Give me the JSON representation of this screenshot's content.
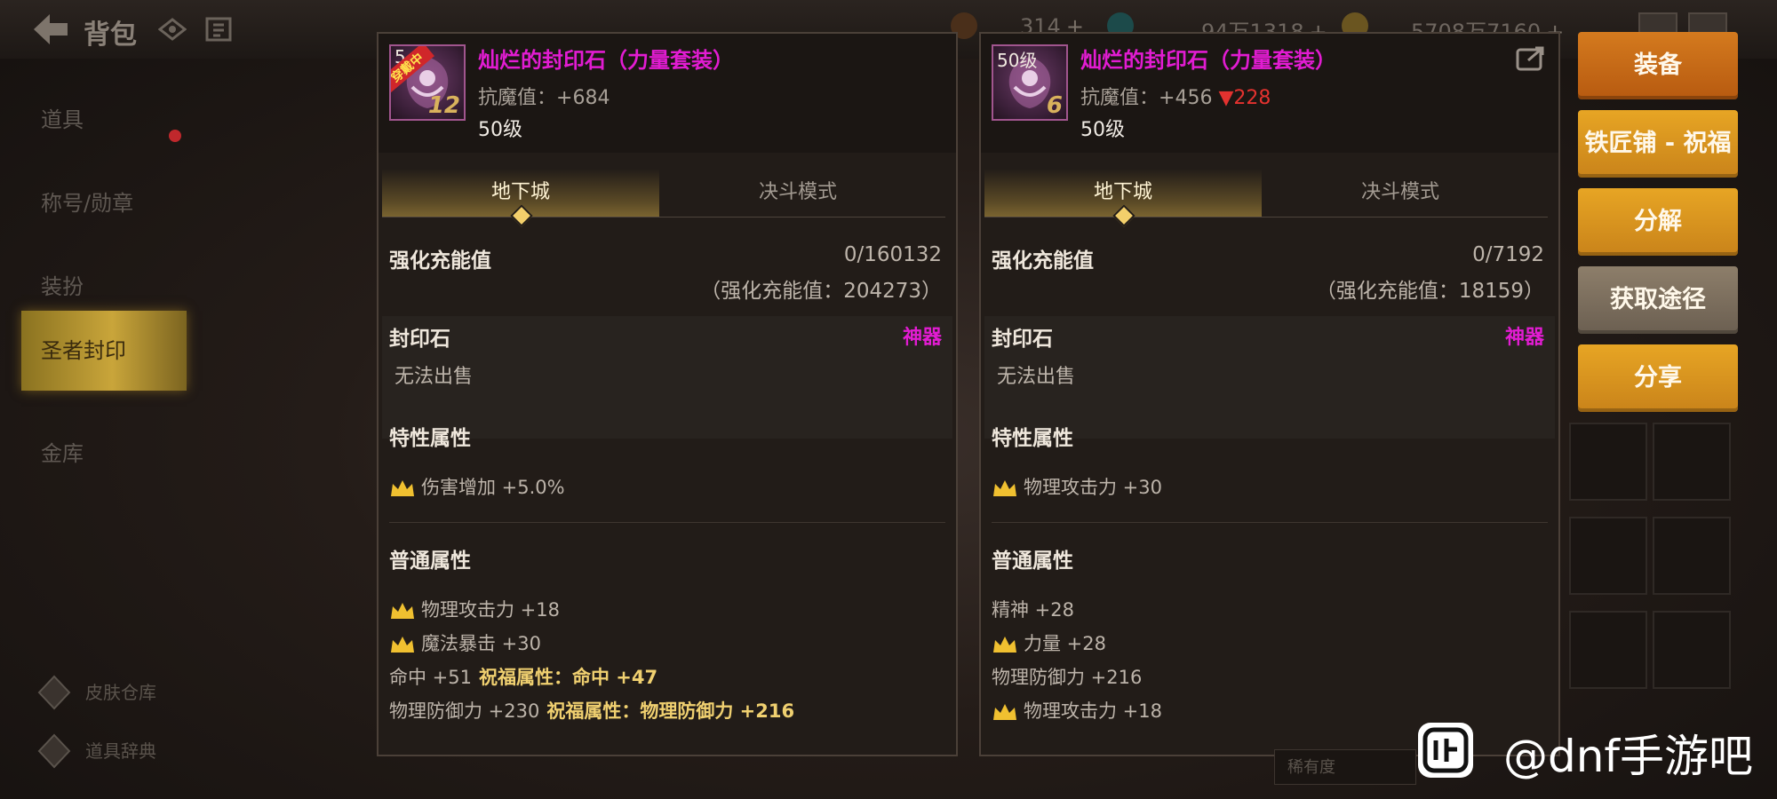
{
  "topbar": {
    "title": "背包",
    "currencies": [
      {
        "value": "314"
      },
      {
        "value": "94万1318"
      },
      {
        "value": "5708万7160"
      }
    ],
    "plus": "+"
  },
  "sidebar": {
    "items": [
      {
        "label": "道具"
      },
      {
        "label": "称号/勋章"
      },
      {
        "label": "装扮"
      },
      {
        "label": "圣者封印"
      },
      {
        "label": "金库"
      }
    ],
    "footer": [
      {
        "label": "皮肤仓库"
      },
      {
        "label": "道具辞典"
      }
    ]
  },
  "panels": [
    {
      "item_name": "灿烂的封印石（力量套装）",
      "icon_level_tag": "5",
      "icon_wear_tag": "穿戴中",
      "icon_level": "12",
      "stat_label": "抗魔值：",
      "stat_value": "+684",
      "stat_diff": "",
      "level": "50级",
      "tabs": [
        "地下城",
        "决斗模式"
      ],
      "charge_label": "强化充能值",
      "charge_value": "0/160132",
      "charge_sub": "（强化充能值：204273）",
      "seal_label": "封印石",
      "seal_rarity": "神器",
      "seal_note": "无法出售",
      "trait_label": "特性属性",
      "traits": [
        {
          "text": "伤害增加 +5.0%"
        }
      ],
      "normal_label": "普通属性",
      "normal": [
        {
          "text": "物理攻击力 +18",
          "bless": ""
        },
        {
          "text": "魔法暴击 +30",
          "bless": ""
        },
        {
          "text": "命中 +51",
          "bless": "祝福属性：命中 +47"
        },
        {
          "text": "物理防御力 +230",
          "bless": "祝福属性：物理防御力 +216"
        }
      ]
    },
    {
      "item_name": "灿烂的封印石（力量套装）",
      "icon_level_tag": "50级",
      "icon_wear_tag": "",
      "icon_level": "6",
      "stat_label": "抗魔值：",
      "stat_value": "+456",
      "stat_diff": "▼228",
      "level": "50级",
      "tabs": [
        "地下城",
        "决斗模式"
      ],
      "charge_label": "强化充能值",
      "charge_value": "0/7192",
      "charge_sub": "（强化充能值：18159）",
      "seal_label": "封印石",
      "seal_rarity": "神器",
      "seal_note": "无法出售",
      "trait_label": "特性属性",
      "traits": [
        {
          "text": "物理攻击力 +30"
        }
      ],
      "normal_label": "普通属性",
      "normal": [
        {
          "text": "精神 +28",
          "bless": ""
        },
        {
          "text": "力量 +28",
          "bless": ""
        },
        {
          "text": "物理防御力 +216",
          "bless": ""
        },
        {
          "text": "物理攻击力 +18",
          "bless": ""
        }
      ]
    }
  ],
  "actions": [
    {
      "label": "装备",
      "style": "orange"
    },
    {
      "label": "铁匠铺 - 祝福",
      "style": "gold"
    },
    {
      "label": "分解",
      "style": "gold"
    },
    {
      "label": "获取途径",
      "style": "grey"
    },
    {
      "label": "分享",
      "style": "gold"
    }
  ],
  "rarity_filter": "稀有度",
  "watermark": "@dnf手游吧",
  "colors": {
    "item_name": "#e21cd2",
    "bless": "#f0d070",
    "down": "#e4322f",
    "equip": "#c86a16",
    "gold_button": "#d8951f"
  }
}
